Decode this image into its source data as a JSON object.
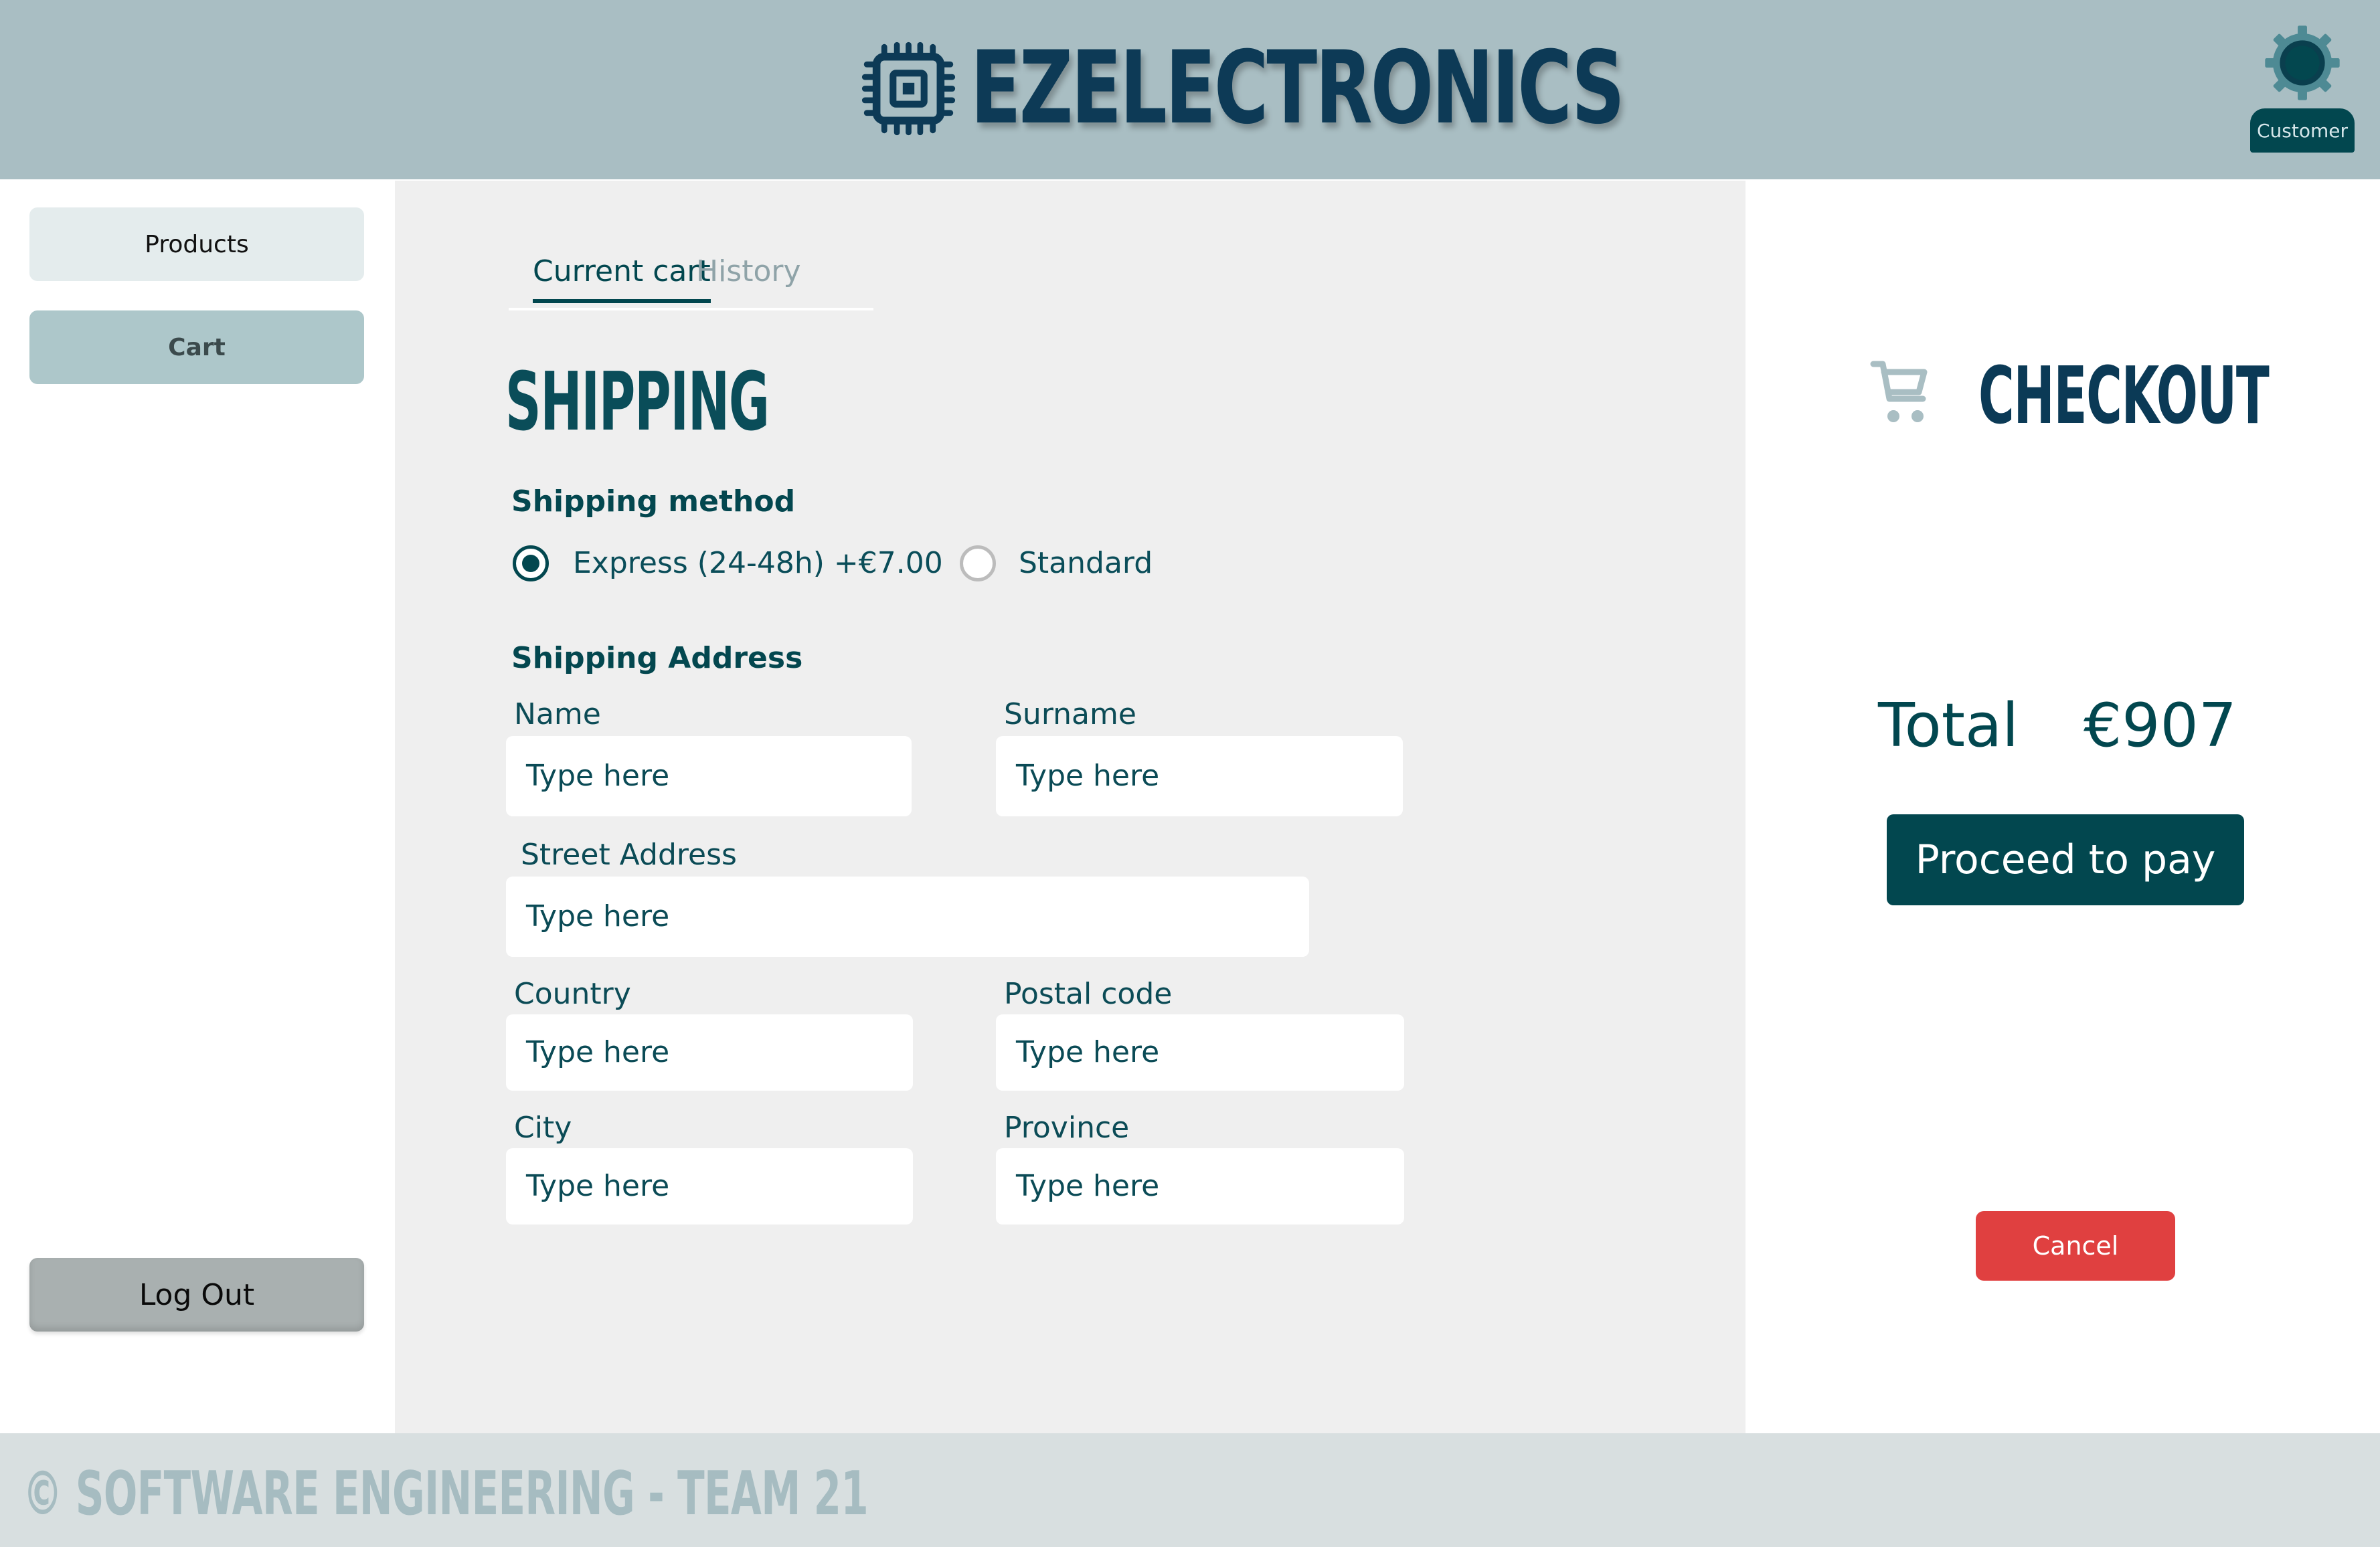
{
  "header": {
    "app_title": "EZELECTRONICS",
    "logo_icon": "chip-icon",
    "user_role": "Customer",
    "user_icon": "gear-icon"
  },
  "sidebar": {
    "items": [
      {
        "label": "Products",
        "active": false
      },
      {
        "label": "Cart",
        "active": true
      }
    ],
    "logout_label": "Log Out"
  },
  "main": {
    "tabs": [
      {
        "label": "Current cart",
        "active": true
      },
      {
        "label": "History",
        "active": false
      }
    ],
    "section_title": "SHIPPING",
    "shipping_method": {
      "label": "Shipping method",
      "options": [
        {
          "label": "Express (24-48h) +€7.00",
          "selected": true
        },
        {
          "label": "Standard",
          "selected": false
        }
      ]
    },
    "shipping_address": {
      "label": "Shipping Address",
      "fields": {
        "name": {
          "label": "Name",
          "placeholder": "Type here",
          "value": ""
        },
        "surname": {
          "label": "Surname",
          "placeholder": "Type here",
          "value": ""
        },
        "street": {
          "label": "Street Address",
          "placeholder": "Type here",
          "value": ""
        },
        "country": {
          "label": "Country",
          "placeholder": "Type here",
          "value": ""
        },
        "postal_code": {
          "label": "Postal code",
          "placeholder": "Type here",
          "value": ""
        },
        "city": {
          "label": "City",
          "placeholder": "Type here",
          "value": ""
        },
        "province": {
          "label": "Province",
          "placeholder": "Type here",
          "value": ""
        }
      }
    }
  },
  "checkout": {
    "icon": "cart-icon",
    "title": "CHECKOUT",
    "total_label": "Total",
    "total_value": "€907",
    "proceed_label": "Proceed to pay",
    "cancel_label": "Cancel"
  },
  "footer": {
    "text": "© SOFTWARE ENGINEERING - TEAM 21"
  },
  "colors": {
    "header_bg": "#a9bec3",
    "primary": "#02474f",
    "title_navy": "#0d3a56",
    "danger": "#e04040",
    "main_bg": "#efefef",
    "footer_bg": "#d8dfe0"
  }
}
